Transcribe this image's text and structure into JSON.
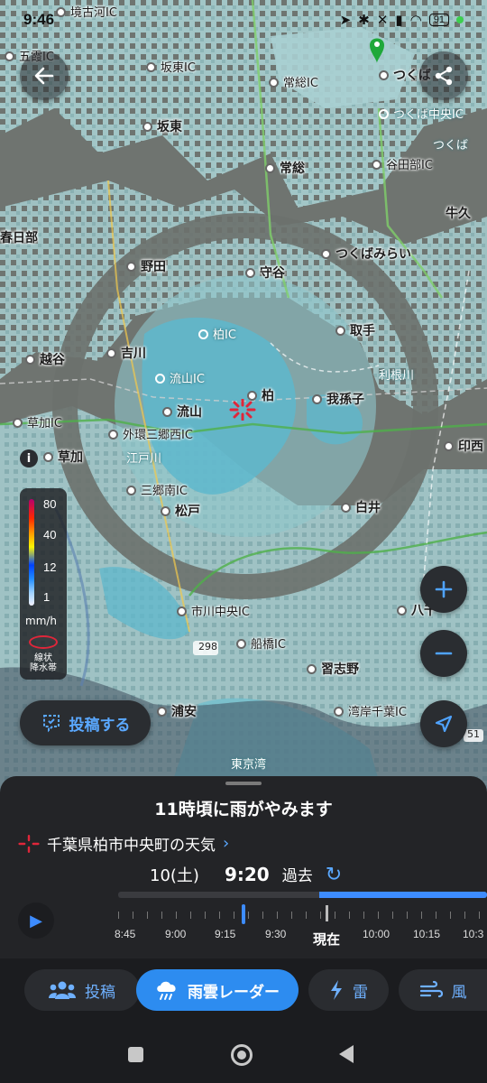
{
  "status_bar": {
    "time": "9:46",
    "battery": "91"
  },
  "map": {
    "labels": [
      {
        "text": "境古河IC",
        "kind": "ic"
      },
      {
        "text": "五霞IC",
        "kind": "ic"
      },
      {
        "text": "坂東IC",
        "kind": "ic"
      },
      {
        "text": "常総IC",
        "kind": "ic"
      },
      {
        "text": "つくば",
        "kind": "city"
      },
      {
        "text": "つくば中央IC",
        "kind": "ic-muted"
      },
      {
        "text": "坂東",
        "kind": "city"
      },
      {
        "text": "常総",
        "kind": "city"
      },
      {
        "text": "谷田部IC",
        "kind": "ic"
      },
      {
        "text": "つくば",
        "kind": "ic-muted"
      },
      {
        "text": "牛久",
        "kind": "city"
      },
      {
        "text": "春日部",
        "kind": "city"
      },
      {
        "text": "つくばみらい",
        "kind": "city"
      },
      {
        "text": "野田",
        "kind": "city"
      },
      {
        "text": "守谷",
        "kind": "city"
      },
      {
        "text": "取手",
        "kind": "city"
      },
      {
        "text": "柏IC",
        "kind": "ic-muted"
      },
      {
        "text": "越谷",
        "kind": "city"
      },
      {
        "text": "吉川",
        "kind": "city"
      },
      {
        "text": "利根川",
        "kind": "river"
      },
      {
        "text": "流山IC",
        "kind": "ic-muted"
      },
      {
        "text": "柏",
        "kind": "city"
      },
      {
        "text": "我孫子",
        "kind": "city"
      },
      {
        "text": "流山",
        "kind": "city"
      },
      {
        "text": "草加IC",
        "kind": "ic"
      },
      {
        "text": "外環三郷西IC",
        "kind": "ic"
      },
      {
        "text": "江戸川",
        "kind": "river"
      },
      {
        "text": "印西",
        "kind": "city"
      },
      {
        "text": "草加",
        "kind": "city"
      },
      {
        "text": "三郷南IC",
        "kind": "ic"
      },
      {
        "text": "松戸",
        "kind": "city"
      },
      {
        "text": "白井",
        "kind": "city"
      },
      {
        "text": "市川中央IC",
        "kind": "ic"
      },
      {
        "text": "八千",
        "kind": "city"
      },
      {
        "text": "298",
        "kind": "route"
      },
      {
        "text": "船橋IC",
        "kind": "ic"
      },
      {
        "text": "習志野",
        "kind": "city"
      },
      {
        "text": "浦安",
        "kind": "city"
      },
      {
        "text": "湾岸千葉IC",
        "kind": "ic"
      },
      {
        "text": "東京湾",
        "kind": "water"
      },
      {
        "text": "51",
        "kind": "route"
      }
    ]
  },
  "legend": {
    "values": [
      "80",
      "40",
      "12",
      "1"
    ],
    "unit": "mm/h",
    "linear_label": "線状\n降水帯"
  },
  "buttons": {
    "post": "投稿する"
  },
  "sheet": {
    "forecast": "11時頃に雨がやみます",
    "location": "千葉県柏市中央町の天気",
    "date": "10(土)",
    "time": "9:20",
    "mode": "過去",
    "timeline_labels": [
      "8:45",
      "9:00",
      "9:15",
      "9:30",
      "10:00",
      "10:15",
      "10:3"
    ],
    "now_label": "現在"
  },
  "tabs": [
    {
      "label": "投稿",
      "icon": "people-icon",
      "active": false
    },
    {
      "label": "雨雲レーダー",
      "icon": "rain-cloud-icon",
      "active": true
    },
    {
      "label": "雷",
      "icon": "lightning-icon",
      "active": false
    },
    {
      "label": "風",
      "icon": "wind-icon",
      "active": false
    }
  ],
  "colors": {
    "accent": "#3d8cff",
    "active_tab": "#2d8cf0",
    "rain_light": "#9fd0d6",
    "rain_medium": "#5bb3c9",
    "location_marker": "#e0263a",
    "pin": "#1fa83a"
  }
}
